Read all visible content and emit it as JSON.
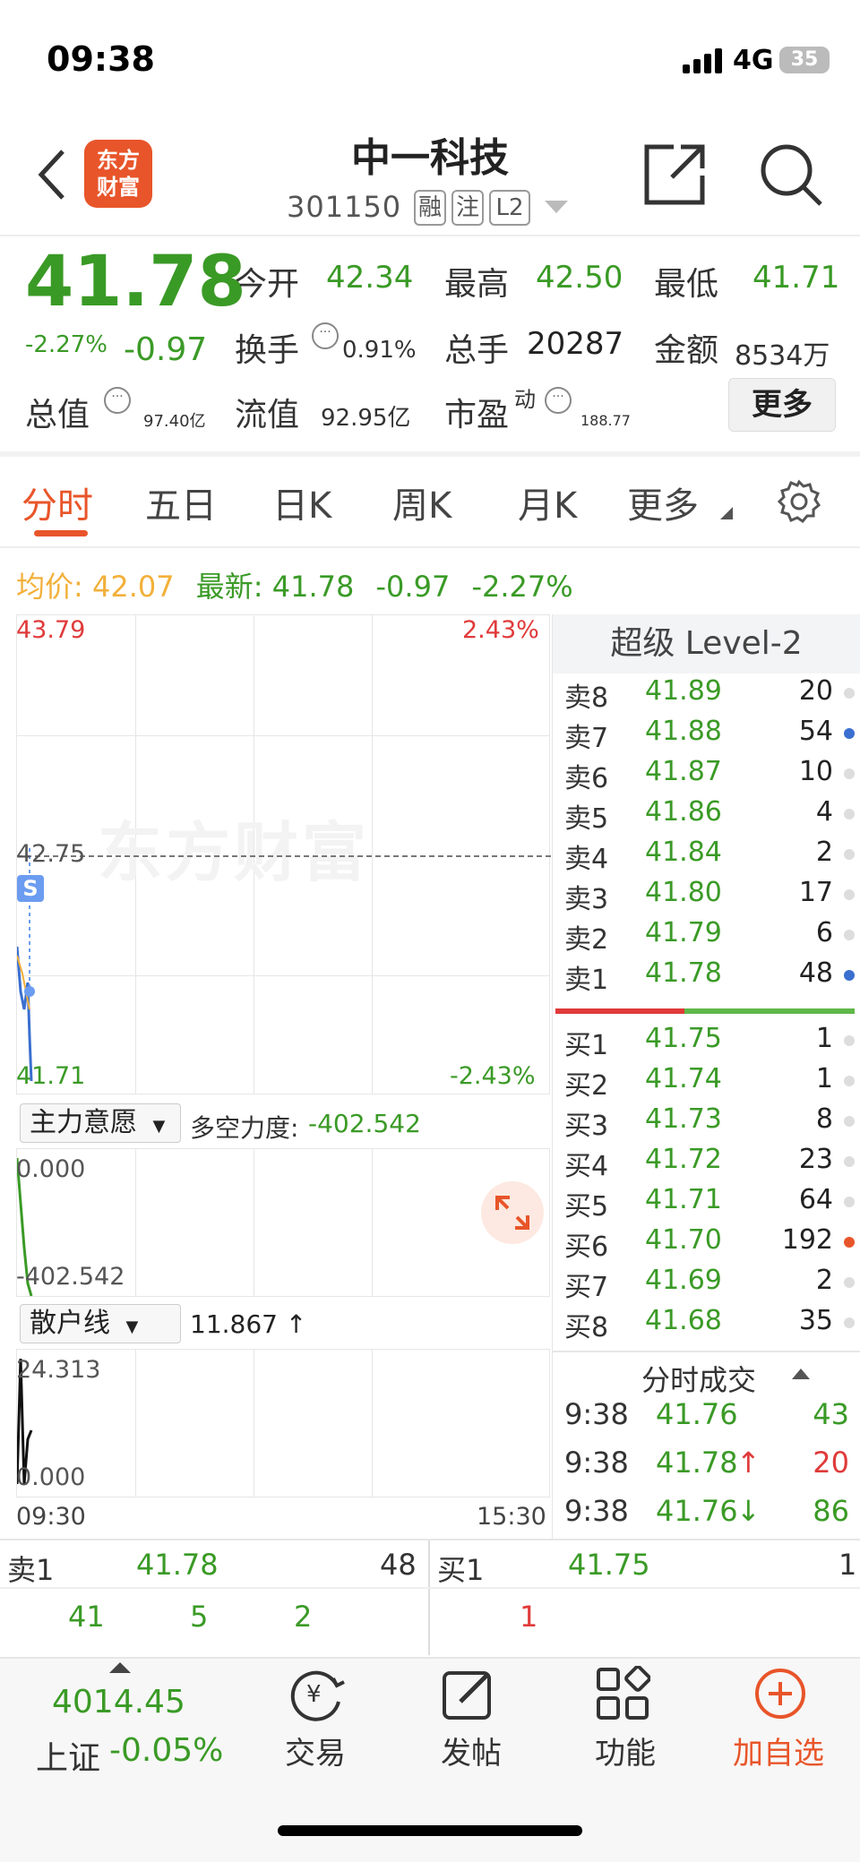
{
  "status": {
    "time": "09:38",
    "network": "4G",
    "battery": "35"
  },
  "header": {
    "logo_line1": "东方",
    "logo_line2": "财富",
    "name": "中一科技",
    "code": "301150",
    "tags": [
      "融",
      "注",
      "L2"
    ]
  },
  "quote": {
    "price": "41.78",
    "pct": "-2.27%",
    "change": "-0.97",
    "open_label": "今开",
    "open": "42.34",
    "high_label": "最高",
    "high": "42.50",
    "low_label": "最低",
    "low": "41.71",
    "turnover_label": "换手",
    "turnover": "0.91%",
    "volume_label": "总手",
    "volume": "20287",
    "amount_label": "金额",
    "amount": "8534万",
    "mktcap_label": "总值",
    "mktcap": "97.40亿",
    "float_label": "流值",
    "float": "92.95亿",
    "pe_label": "市盈",
    "pe_sup": "动",
    "pe": "188.77",
    "more": "更多"
  },
  "tabs": [
    "分时",
    "五日",
    "日K",
    "周K",
    "月K",
    "更多"
  ],
  "avg": {
    "avg_label": "均价:",
    "avg": "42.07",
    "latest_label": "最新:",
    "latest": "41.78",
    "chg": "-0.97",
    "pct": "-2.27%"
  },
  "chart": {
    "top_price": "43.79",
    "top_pct": "2.43%",
    "mid_price": "42.75",
    "bottom_price": "41.71",
    "bottom_pct": "-2.43%",
    "watermark": "东方财富",
    "marker": "S",
    "start_time": "09:30",
    "end_time": "15:30",
    "ind1_name": "主力意愿",
    "ind1_label": "多空力度:",
    "ind1_value": "-402.542",
    "ind1_top": "0.000",
    "ind1_bottom": "-402.542",
    "ind2_name": "散户线",
    "ind2_value": "11.867 ↑",
    "ind2_top": "24.313",
    "ind2_bottom": "0.000"
  },
  "level2": {
    "title": "超级 Level-2",
    "asks": [
      {
        "label": "卖8",
        "price": "41.89",
        "vol": "20",
        "dot": "#dddddd"
      },
      {
        "label": "卖7",
        "price": "41.88",
        "vol": "54",
        "dot": "#3a6fd0"
      },
      {
        "label": "卖6",
        "price": "41.87",
        "vol": "10",
        "dot": "#dddddd"
      },
      {
        "label": "卖5",
        "price": "41.86",
        "vol": "4",
        "dot": "#dddddd"
      },
      {
        "label": "卖4",
        "price": "41.84",
        "vol": "2",
        "dot": "#dddddd"
      },
      {
        "label": "卖3",
        "price": "41.80",
        "vol": "17",
        "dot": "#dddddd"
      },
      {
        "label": "卖2",
        "price": "41.79",
        "vol": "6",
        "dot": "#dddddd"
      },
      {
        "label": "卖1",
        "price": "41.78",
        "vol": "48",
        "dot": "#3a6fd0"
      }
    ],
    "bids": [
      {
        "label": "买1",
        "price": "41.75",
        "vol": "1",
        "dot": "#dddddd"
      },
      {
        "label": "买2",
        "price": "41.74",
        "vol": "1",
        "dot": "#dddddd"
      },
      {
        "label": "买3",
        "price": "41.73",
        "vol": "8",
        "dot": "#dddddd"
      },
      {
        "label": "买4",
        "price": "41.72",
        "vol": "23",
        "dot": "#dddddd"
      },
      {
        "label": "买5",
        "price": "41.71",
        "vol": "64",
        "dot": "#dddddd"
      },
      {
        "label": "买6",
        "price": "41.70",
        "vol": "192",
        "dot": "#e8552a"
      },
      {
        "label": "买7",
        "price": "41.69",
        "vol": "2",
        "dot": "#dddddd"
      },
      {
        "label": "买8",
        "price": "41.68",
        "vol": "35",
        "dot": "#dddddd"
      }
    ],
    "trades_title": "分时成交",
    "trades": [
      {
        "time": "9:38",
        "price": "41.76",
        "arrow": "",
        "vol": "43",
        "vol_color": "#3a9a26"
      },
      {
        "time": "9:38",
        "price": "41.78",
        "arrow": "↑",
        "vol": "20",
        "vol_color": "#e03a3a"
      },
      {
        "time": "9:38",
        "price": "41.76",
        "arrow": "↓",
        "vol": "86",
        "vol_color": "#3a9a26"
      }
    ]
  },
  "strip": {
    "ask_label": "卖1",
    "ask_price": "41.78",
    "ask_vol": "48",
    "bid_label": "买1",
    "bid_price": "41.75",
    "bid_vol": "1",
    "ask_details": [
      "41",
      "5",
      "2"
    ],
    "bid_details": [
      "1"
    ]
  },
  "nav": {
    "index_value": "4014.45",
    "index_name": "上证",
    "index_pct": "-0.05%",
    "trade": "交易",
    "post": "发帖",
    "func": "功能",
    "watch": "加自选"
  }
}
